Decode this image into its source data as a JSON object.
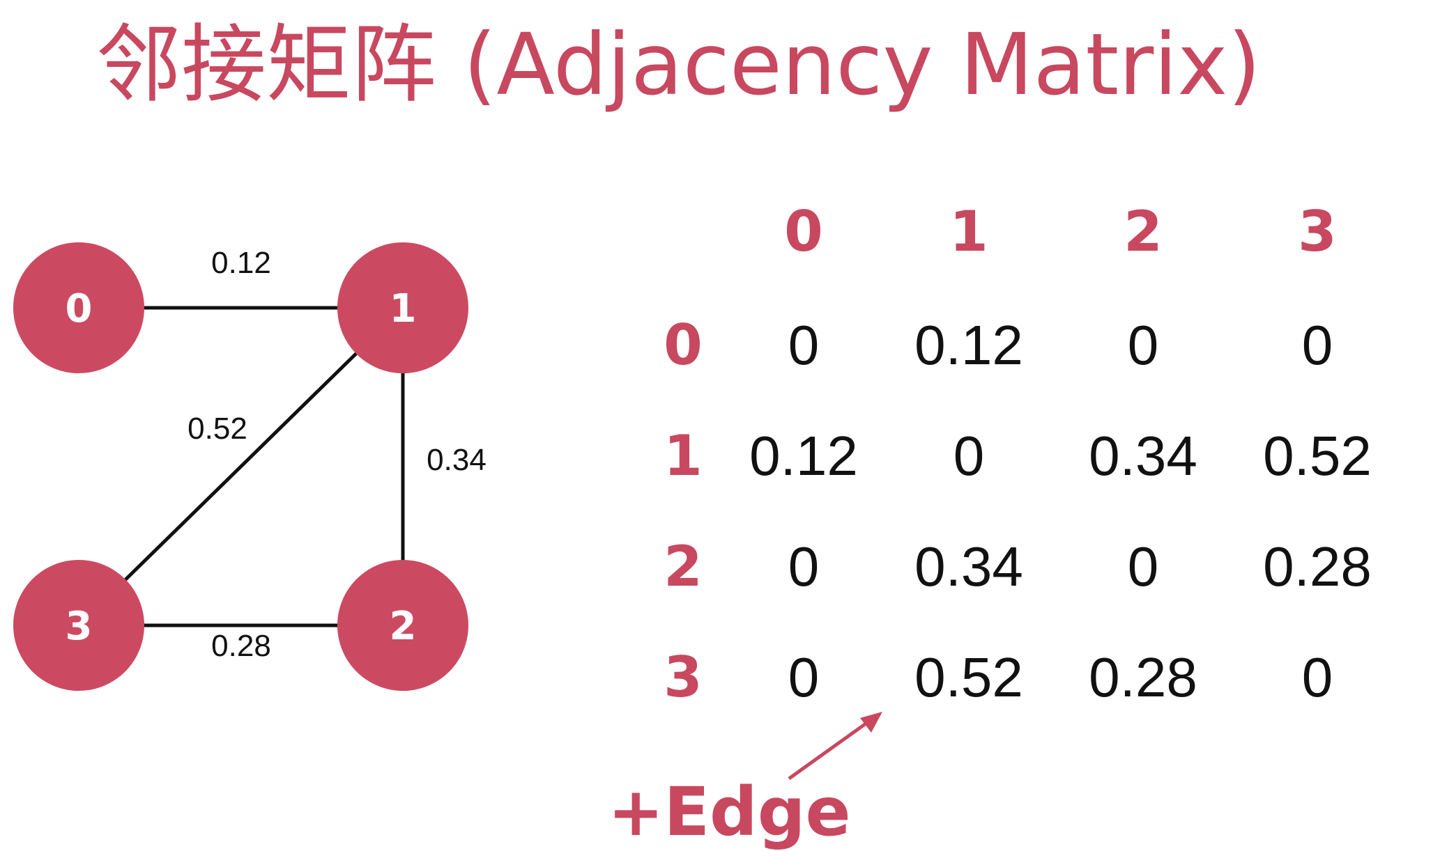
{
  "title": "邻接矩阵 (Adjacency Matrix)",
  "colors": {
    "accent": "#c8485f",
    "node_fill": "#cc4a61",
    "edge": "#111111",
    "text": "#111111"
  },
  "graph": {
    "nodes": [
      "0",
      "1",
      "2",
      "3"
    ],
    "edges": [
      {
        "from": "0",
        "to": "1",
        "weight": "0.12"
      },
      {
        "from": "1",
        "to": "3",
        "weight": "0.52"
      },
      {
        "from": "1",
        "to": "2",
        "weight": "0.34"
      },
      {
        "from": "3",
        "to": "2",
        "weight": "0.28"
      }
    ]
  },
  "matrix": {
    "col_headers": [
      "0",
      "1",
      "2",
      "3"
    ],
    "row_headers": [
      "0",
      "1",
      "2",
      "3"
    ],
    "rows": [
      [
        "0",
        "0.12",
        "0",
        "0"
      ],
      [
        "0.12",
        "0",
        "0.34",
        "0.52"
      ],
      [
        "0",
        "0.34",
        "0",
        "0.28"
      ],
      [
        "0",
        "0.52",
        "0.28",
        "0"
      ]
    ]
  },
  "annotation": {
    "text": "+Edge"
  }
}
